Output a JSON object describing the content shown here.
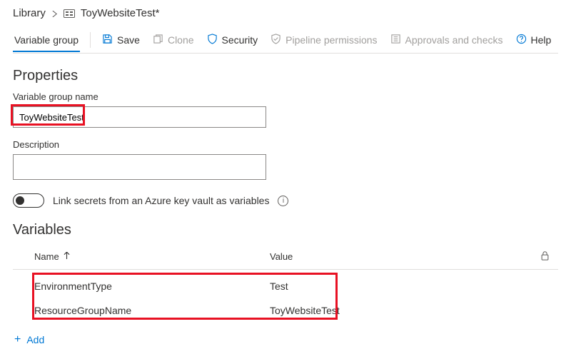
{
  "breadcrumb": {
    "library": "Library",
    "title": "ToyWebsiteTest*"
  },
  "toolbar": {
    "tab": "Variable group",
    "save": "Save",
    "clone": "Clone",
    "security": "Security",
    "pipeline_permissions": "Pipeline permissions",
    "approvals": "Approvals and checks",
    "help": "Help"
  },
  "properties": {
    "heading": "Properties",
    "name_label": "Variable group name",
    "name_value": "ToyWebsiteTest",
    "desc_label": "Description",
    "desc_value": "",
    "kv_toggle_label": "Link secrets from an Azure key vault as variables"
  },
  "variables": {
    "heading": "Variables",
    "col_name": "Name",
    "col_value": "Value",
    "rows": [
      {
        "name": "EnvironmentType",
        "value": "Test"
      },
      {
        "name": "ResourceGroupName",
        "value": "ToyWebsiteTest"
      }
    ],
    "add_label": "Add"
  }
}
